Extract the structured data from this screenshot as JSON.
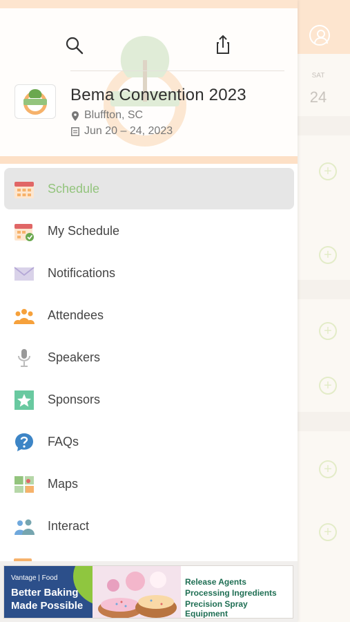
{
  "header": {
    "event_title": "Bema Convention 2023",
    "location": "Bluffton, SC",
    "dates": "Jun 20 – 24, 2023"
  },
  "menu": {
    "items": [
      {
        "label": "Schedule",
        "icon": "calendar-icon",
        "selected": true
      },
      {
        "label": "My Schedule",
        "icon": "calendar-check-icon"
      },
      {
        "label": "Notifications",
        "icon": "envelope-icon"
      },
      {
        "label": "Attendees",
        "icon": "people-group-icon"
      },
      {
        "label": "Speakers",
        "icon": "microphone-icon"
      },
      {
        "label": "Sponsors",
        "icon": "star-icon"
      },
      {
        "label": "FAQs",
        "icon": "question-bubble-icon"
      },
      {
        "label": "Maps",
        "icon": "map-icon"
      },
      {
        "label": "Interact",
        "icon": "people-icon"
      }
    ]
  },
  "background": {
    "day_label": "SAT",
    "day_number": "24"
  },
  "banner": {
    "brand": "Vantage | Food",
    "headline_line1": "Better Baking",
    "headline_line2": "Made Possible",
    "lines": [
      "Release Agents",
      "Processing Ingredients",
      "Precision Spray Equipment"
    ]
  },
  "colors": {
    "accent_green": "#93c47d",
    "header_peach": "#fde5cf",
    "selected_bg": "#e6e6e6"
  }
}
